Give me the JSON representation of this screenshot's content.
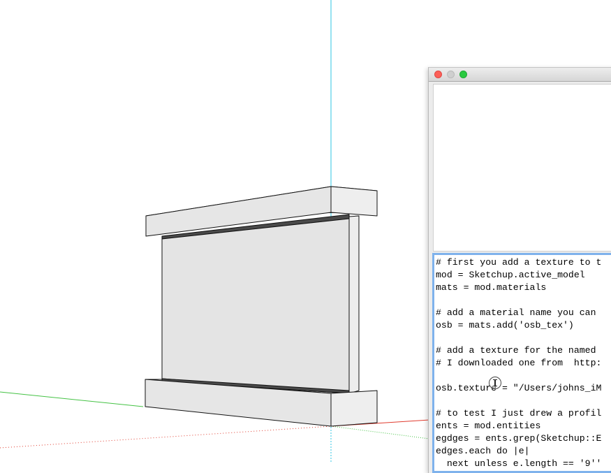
{
  "viewport": {
    "axis_colors": {
      "blue": "#2fc4e3",
      "green": "#44c244",
      "red": "#e03b2e"
    },
    "model_fill": "#e8e8e8",
    "model_dark": "#4a4a4a"
  },
  "console": {
    "traffic_lights": {
      "close": "#fc5f57",
      "minimize": "#cfcfcf",
      "zoom": "#2ac940"
    },
    "code_lines": [
      "# first you add a texture to t",
      "mod = Sketchup.active_model",
      "mats = mod.materials",
      "",
      "# add a material name you can",
      "osb = mats.add('osb_tex')",
      "",
      "# add a texture for the named",
      "# I downloaded one from  http:",
      "",
      "osb.texture = \"/Users/johns_iM",
      "",
      "# to test I just drew a profil",
      "ents = mod.entities",
      "egdges = ents.grep(Sketchup::E",
      "edges.each do |e|",
      "  next unless e.length == '9''"
    ]
  }
}
